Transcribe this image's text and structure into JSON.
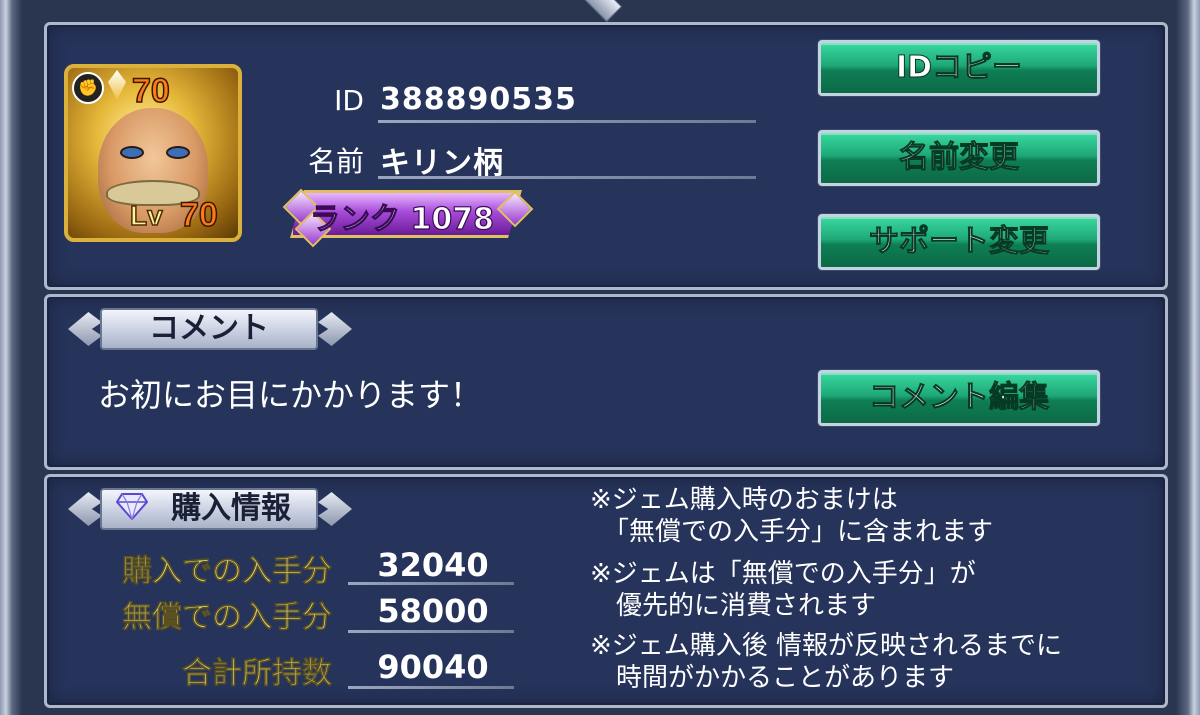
{
  "profile": {
    "id_label": "ID",
    "id_value": "388890535",
    "name_label": "名前",
    "name_value": "キリン柄",
    "rank_text": "ランク 1078",
    "avatar": {
      "level_top": "70",
      "level_label": "Lv",
      "level_value": "70",
      "job_icon": "fist-icon"
    }
  },
  "buttons": {
    "id_copy": "IDコピー",
    "name_change": "名前変更",
    "support_change": "サポート変更",
    "comment_edit": "コメント編集"
  },
  "comment": {
    "tab_label": "コメント",
    "text": "お初にお目にかかります！"
  },
  "purchase": {
    "tab_label": "購入情報",
    "rows": [
      {
        "label": "購入での入手分",
        "value": "32040"
      },
      {
        "label": "無償での入手分",
        "value": "58000"
      },
      {
        "label": "合計所持数",
        "value": "90040"
      }
    ],
    "notes": [
      "※ジェム購入時のおまけは\n　「無償での入手分」に含まれます",
      "※ジェムは「無償での入手分」が\n　優先的に消費されます",
      "※ジェム購入後 情報が反映されるまでに\n　時間がかかることがあります"
    ]
  },
  "colors": {
    "panel_bg": "#26335a",
    "button_green": "#1ea878",
    "rank_purple": "#a64bd8",
    "stat_label": "#e6dc8a"
  }
}
